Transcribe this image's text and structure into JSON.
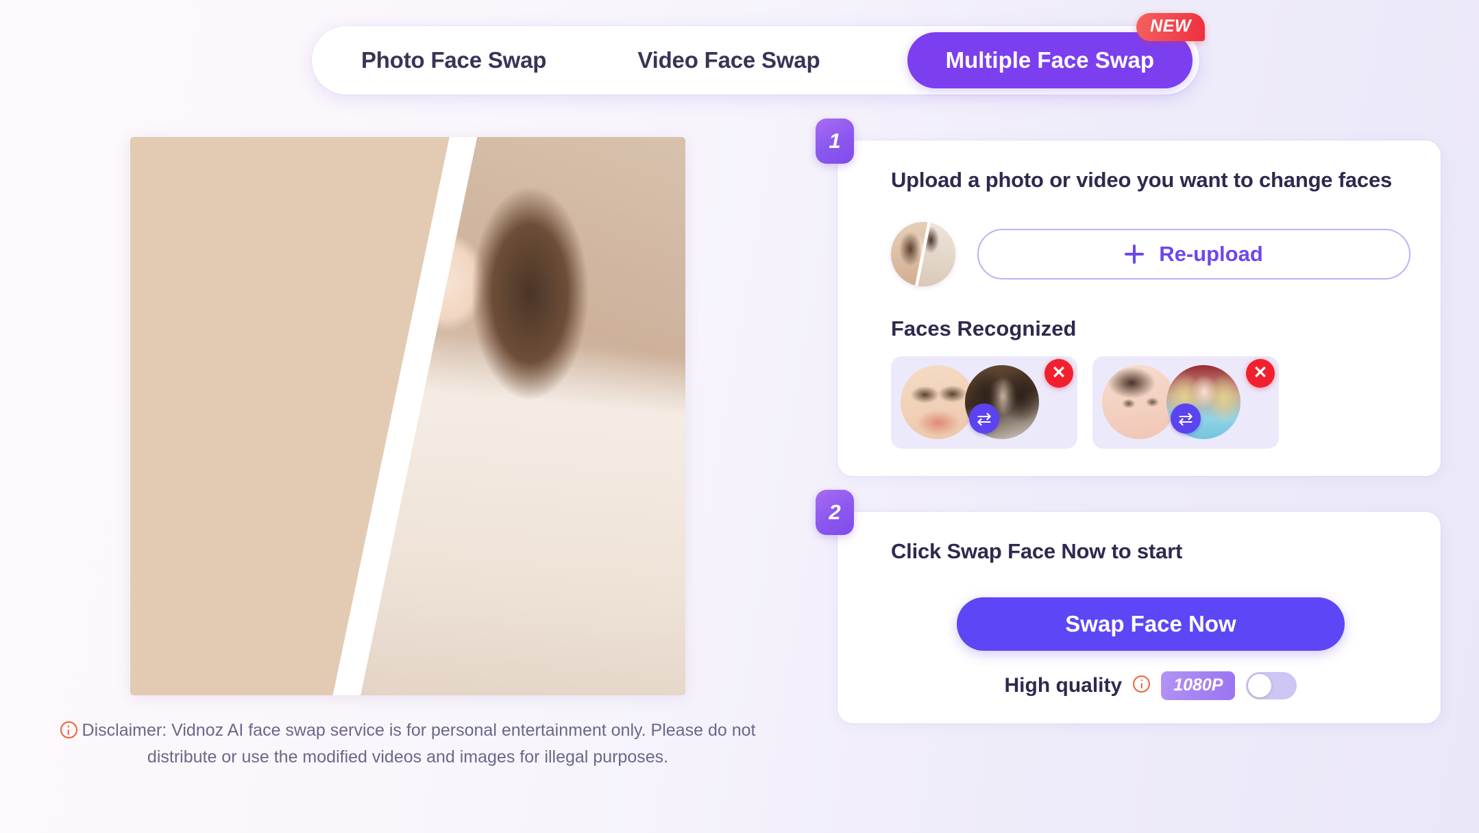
{
  "tabs": {
    "photo": "Photo Face Swap",
    "video": "Video Face Swap",
    "multiple": "Multiple Face Swap",
    "new_badge": "NEW",
    "active": "Multiple Face Swap"
  },
  "preview": {
    "alt": "face-swap-before-after-split-preview"
  },
  "disclaimer": {
    "icon": "info-circle-icon",
    "text": "Disclaimer: Vidnoz AI face swap service is for personal entertainment only. Please do not distribute or use the modified videos and images for illegal purposes."
  },
  "step1": {
    "number": "1",
    "title": "Upload a photo or video you want to change faces",
    "thumbnail_name": "uploaded-photo-thumbnail",
    "reupload_label": "Re-upload",
    "plus_icon": "plus-icon",
    "faces_label": "Faces Recognized",
    "face_pairs": [
      {
        "source_name": "detected-face-1",
        "target_name": "replacement-face-1",
        "swap_icon": "swap-arrows-icon",
        "delete_icon": "delete-icon",
        "delete_glyph": "✕",
        "swap_glyph": "⇄"
      },
      {
        "source_name": "detected-face-2",
        "target_name": "replacement-face-2",
        "swap_icon": "swap-arrows-icon",
        "delete_icon": "delete-icon",
        "delete_glyph": "✕",
        "swap_glyph": "⇄"
      }
    ]
  },
  "step2": {
    "number": "2",
    "title": "Click Swap Face Now to start",
    "swap_button_label": "Swap Face Now",
    "high_quality_label": "High quality",
    "high_quality_info_icon": "info-circle-icon",
    "resolution_badge": "1080P",
    "toggle_state": "off"
  },
  "colors": {
    "accent_purple": "#7b3fef",
    "button_purple": "#5d46f5",
    "badge_red": "#ee2f3f",
    "info_orange": "#ef6133",
    "text_dark": "#2e2a4e",
    "card_lavender": "#ece9fb"
  }
}
